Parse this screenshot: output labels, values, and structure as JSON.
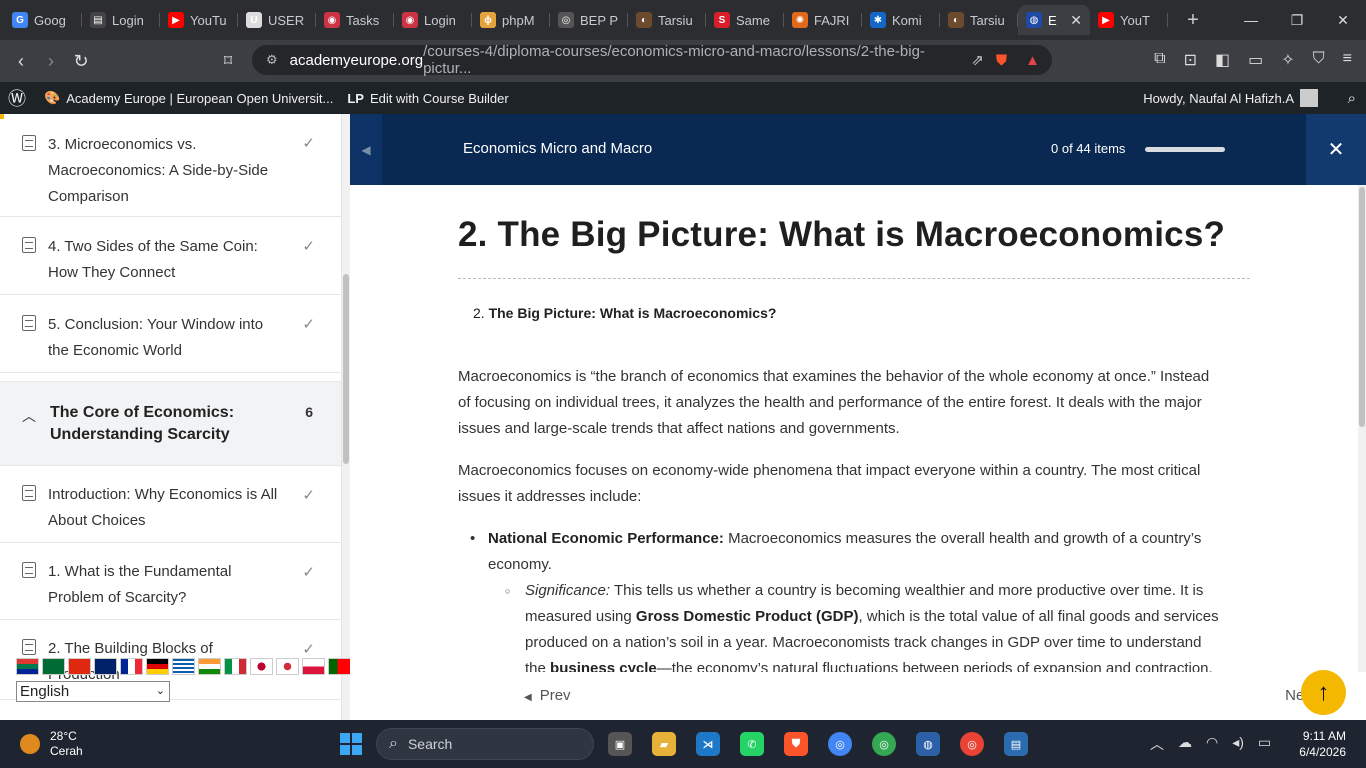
{
  "browser": {
    "tabs": [
      {
        "label": "Goog",
        "color": "#4285f4",
        "glyph": "G"
      },
      {
        "label": "Login",
        "color": "#444444",
        "glyph": "▤"
      },
      {
        "label": "YouTu",
        "color": "#ff0000",
        "glyph": "▶"
      },
      {
        "label": "USER",
        "color": "#dddddd",
        "glyph": "U"
      },
      {
        "label": "Tasks",
        "color": "#cc3344",
        "glyph": "◉"
      },
      {
        "label": "Login",
        "color": "#cc3344",
        "glyph": "◉"
      },
      {
        "label": "phpM",
        "color": "#e7a33b",
        "glyph": "ɸ"
      },
      {
        "label": "BEP P",
        "color": "#555555",
        "glyph": "◎"
      },
      {
        "label": "Tarsiu",
        "color": "#6b4a2e",
        "glyph": "◐"
      },
      {
        "label": "Same",
        "color": "#d81e2a",
        "glyph": "S"
      },
      {
        "label": "FAJRI",
        "color": "#e06a1a",
        "glyph": "✺"
      },
      {
        "label": "Komi",
        "color": "#1466c8",
        "glyph": "✱"
      },
      {
        "label": "Tarsiu",
        "color": "#6b4a2e",
        "glyph": "◐"
      },
      {
        "label": "E",
        "color": "#1f4aa8",
        "glyph": "◍",
        "active": true
      },
      {
        "label": "YouT",
        "color": "#ff0000",
        "glyph": "▶"
      }
    ],
    "url_host": "academyeurope.org",
    "url_path": "/courses-4/diploma-courses/economics-micro-and-macro/lessons/2-the-big-pictur..."
  },
  "adminbar": {
    "site": "Academy Europe | European Open Universit...",
    "builder": "Edit with Course Builder",
    "user": "Howdy, Naufal Al Hafizh.A"
  },
  "sidebar": {
    "lessons_top": [
      "3. Microeconomics vs. Macroeconomics: A Side-by-Side Comparison",
      "4. Two Sides of the Same Coin: How They Connect",
      "5. Conclusion: Your Window into the Economic World"
    ],
    "topic": {
      "title": "The Core of Economics: Understanding Scarcity",
      "count": "6"
    },
    "lessons_bottom": [
      "Introduction: Why Economics is All About Choices",
      "1. What is the Fundamental Problem of Scarcity?",
      "2. The Building Blocks of Production"
    ],
    "language": "English"
  },
  "course": {
    "title": "Economics Micro and Macro",
    "progress_label": "0 of 44 items",
    "progress_fraction": 0
  },
  "content": {
    "heading": "2. The Big Picture: What is Macroeconomics?",
    "toc_num": "2.",
    "toc_title": "The Big Picture: What is Macroeconomics?",
    "p1": "Macroeconomics is “the branch of economics that examines the behavior of the whole economy at once.” Instead of focusing on individual trees, it analyzes the health and performance of the entire forest. It deals with the major issues and large-scale trends that affect nations and governments.",
    "p2": "Macroeconomics focuses on economy-wide phenomena that impact everyone within a country. The most critical issues it addresses include:",
    "bullet1_bold": "National Economic Performance:",
    "bullet1_text": " Macroeconomics measures the overall health and growth of a country’s economy.",
    "sub1_italic": "Significance:",
    "sub1_text1": " This tells us whether a country is becoming wealthier and more productive over time. It is measured using ",
    "sub1_bold": "Gross Domestic Product (GDP)",
    "sub1_text2": ", which is the total value of all final goods and services produced on a nation’s soil in a year. Macroeconomists track changes in GDP over time to understand the ",
    "sub1_bold2": "business cycle",
    "sub1_text3": "—the economy’s natural fluctuations between periods of expansion and contraction."
  },
  "footer": {
    "prev": "Prev",
    "next": "Next"
  },
  "taskbar": {
    "temp": "28°C",
    "weather": "Cerah",
    "search": "Search",
    "time": "9:11 AM",
    "date": "6/4/2026"
  }
}
